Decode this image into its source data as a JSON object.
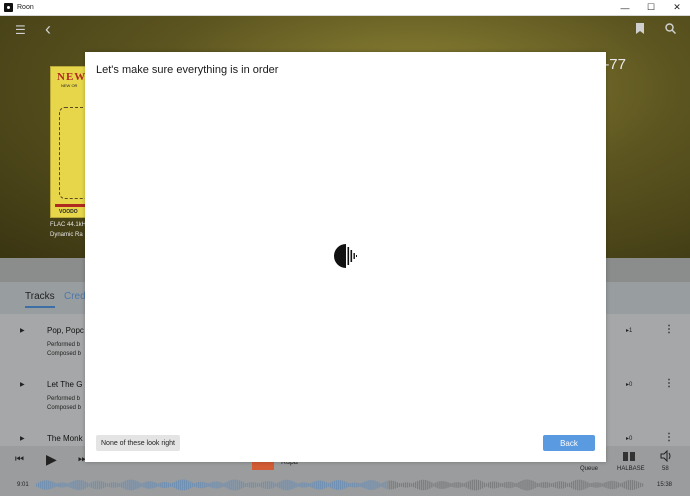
{
  "window": {
    "title": "Roon",
    "minimize_glyph": "—",
    "maximize_glyph": "☐",
    "close_glyph": "✕"
  },
  "header": {
    "menu_icon": "☰",
    "back_icon": "‹",
    "bookmark_icon": "bookmark-icon",
    "search_icon": "search-icon"
  },
  "album": {
    "cover_title": "NEW",
    "cover_subtitle": "NEW OR",
    "cover_footer": "VOODO",
    "format": "FLAC 44.1kH",
    "dynamic_range": "Dynamic Ra",
    "year_fragment": "-77"
  },
  "tabs": [
    {
      "label": "Tracks",
      "active": true
    },
    {
      "label": "Cred",
      "active": false
    }
  ],
  "tracks": [
    {
      "play_icon": "▶",
      "title": "Pop, Popc",
      "performed": "Performed b",
      "composed": "Composed b",
      "count": "▸1",
      "more": "⋮"
    },
    {
      "play_icon": "▶",
      "title": "Let The G",
      "performed": "Performed b",
      "composed": "Composed b",
      "count": "▸0",
      "more": "⋮"
    },
    {
      "play_icon": "▶",
      "title": "The Monk",
      "count": "▸0",
      "more": "⋮"
    }
  ],
  "player": {
    "prev_icon": "⏮",
    "play_icon": "▶",
    "next_icon": "⏭",
    "now_playing": "Rupa",
    "queue_label": "Queue",
    "zone_label": "HALBASE",
    "volume": "58",
    "elapsed": "9:01",
    "total": "15:38",
    "progress_fraction": 0.58
  },
  "modal": {
    "title": "Let's make sure everything is in order",
    "none_button": "None of these look right",
    "back_button": "Back",
    "accent_color": "#5a9ae0"
  }
}
